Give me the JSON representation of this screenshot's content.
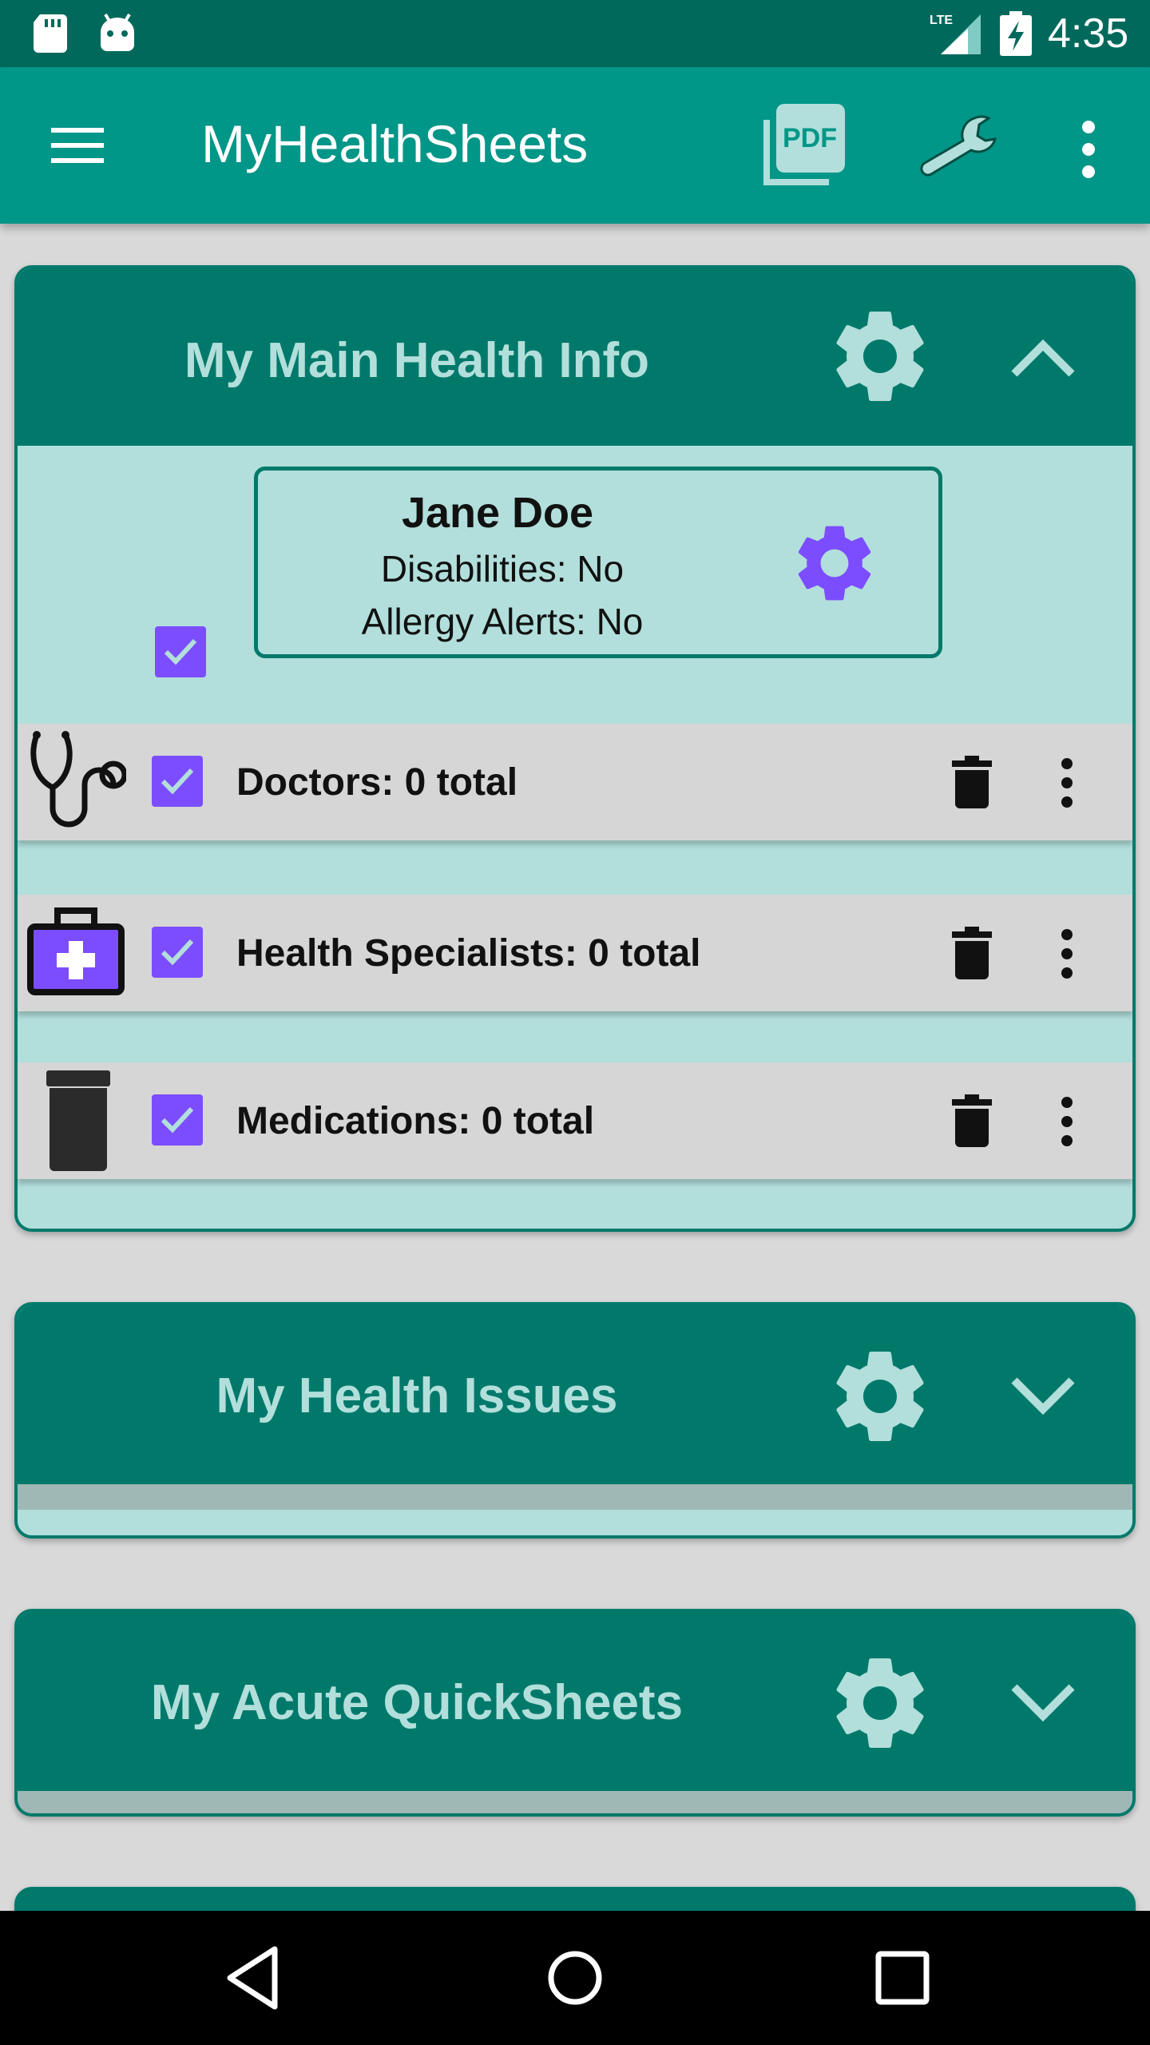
{
  "status_bar": {
    "time": "4:35",
    "network": "LTE",
    "icons": [
      "sd-card-icon",
      "android-icon",
      "lte-signal-icon",
      "battery-charging-icon"
    ]
  },
  "app_bar": {
    "title": "MyHealthSheets",
    "icons": [
      "menu-icon",
      "pdf-icon",
      "wrench-icon",
      "more-vert-icon"
    ]
  },
  "sections": [
    {
      "title": "My Main Health Info",
      "expanded": true,
      "profile": {
        "name": "Jane Doe",
        "disabilities": "Disabilities: No",
        "allergy_alerts": "Allergy Alerts: No",
        "checked": true
      },
      "rows": [
        {
          "label": "Doctors: 0 total",
          "icon": "stethoscope-icon",
          "checked": true
        },
        {
          "label": "Health Specialists: 0 total",
          "icon": "medical-kit-icon",
          "checked": true
        },
        {
          "label": "Medications: 0 total",
          "icon": "pill-bottle-icon",
          "checked": true
        }
      ]
    },
    {
      "title": "My Health Issues",
      "expanded": false
    },
    {
      "title": "My Acute QuickSheets",
      "expanded": false
    }
  ],
  "colors": {
    "status_bar": "#00695c",
    "app_bar": "#009688",
    "card_header": "#00796b",
    "card_body": "#b2dfdb",
    "checkbox": "#7c4dff",
    "row_background": "#d6d6d6"
  },
  "nav_bar": {
    "icons": [
      "back-icon",
      "home-icon",
      "recents-icon"
    ]
  }
}
